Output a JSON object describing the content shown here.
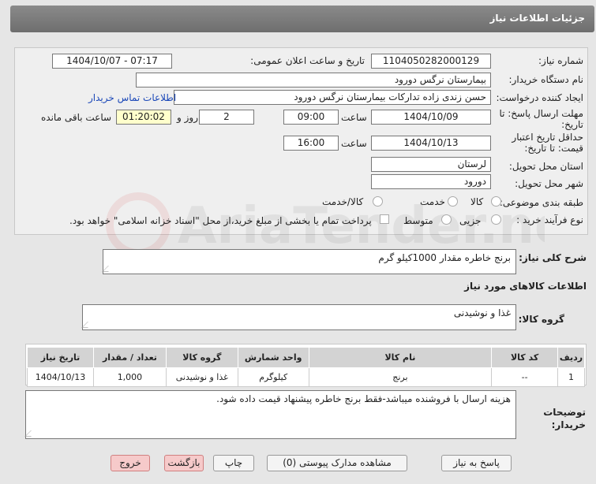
{
  "header": {
    "title": "جزئیات اطلاعات نیاز"
  },
  "fields": {
    "need_number_label": "شماره نیاز:",
    "need_number": "1104050282000129",
    "announce_label": "تاریخ و ساعت اعلان عمومی:",
    "announce_value": "1404/10/07 - 07:17",
    "buyer_label": "نام دستگاه خریدار:",
    "buyer_value": "بیمارستان نرگس دورود",
    "creator_label": "ایجاد کننده درخواست:",
    "creator_value": "حسن  زندی زاده  تدارکات بیمارستان نرگس دورود",
    "contact_link": "اطلاعات تماس خریدار",
    "deadline_label_1": "مهلت ارسال پاسخ: تا",
    "deadline_label_2": "تاریخ:",
    "deadline_date": "1404/10/09",
    "deadline_time_label": "ساعت",
    "deadline_time": "09:00",
    "days": "2",
    "days_label": "روز و",
    "remaining": "01:20:02",
    "remaining_label": "ساعت باقی مانده",
    "validity_label_1": "حداقل تاریخ اعتبار",
    "validity_label_2": "قیمت: تا تاریخ:",
    "validity_date": "1404/10/13",
    "validity_time_label": "ساعت",
    "validity_time": "16:00",
    "province_label": "استان محل تحویل:",
    "province_value": "لرستان",
    "city_label": "شهر محل تحویل:",
    "city_value": "دورود",
    "category_label": "طبقه بندی موضوعی:",
    "category_options": [
      "کالا",
      "خدمت",
      "کالا/خدمت"
    ],
    "process_label": "نوع فرآیند خرید :",
    "process_options": [
      "جزیی",
      "متوسط"
    ],
    "payment_note": "پرداخت تمام یا بخشی از مبلغ خرید،از محل \"اسناد خزانه اسلامی\" خواهد بود."
  },
  "description": {
    "label": "شرح کلی نیاز:",
    "value": "برنج خاطره مقدار 1000کیلو گرم"
  },
  "goods_info_title": "اطلاعات کالاهای مورد نیاز",
  "goods_group": {
    "label": "گروه کالا:",
    "value": "غذا و نوشیدنی"
  },
  "table": {
    "headers": [
      "ردیف",
      "کد کالا",
      "نام کالا",
      "واحد شمارش",
      "گروه کالا",
      "تعداد / مقدار",
      "تاریخ نیاز"
    ],
    "rows": [
      [
        "1",
        "--",
        "برنج",
        "کیلوگرم",
        "غذا و نوشیدنی",
        "1,000",
        "1404/10/13"
      ]
    ]
  },
  "buyer_notes": {
    "label_1": "توضیحات",
    "label_2": "خریدار:",
    "value": "هزینه ارسال با فروشنده میباشد-فقط برنج خاطره پیشنهاد قیمت داده شود."
  },
  "buttons": {
    "reply": "پاسخ به نیاز",
    "docs": "مشاهده مدارک پیوستی (0)",
    "print": "چاپ",
    "back": "بازگشت",
    "exit": "خروج"
  },
  "watermark": "AriaTender.neT",
  "colors": {
    "link": "#1a47b8",
    "titlebar": "#7a7a7a",
    "timer_bg": "#ffffcc",
    "danger_btn": "#f6caca"
  }
}
